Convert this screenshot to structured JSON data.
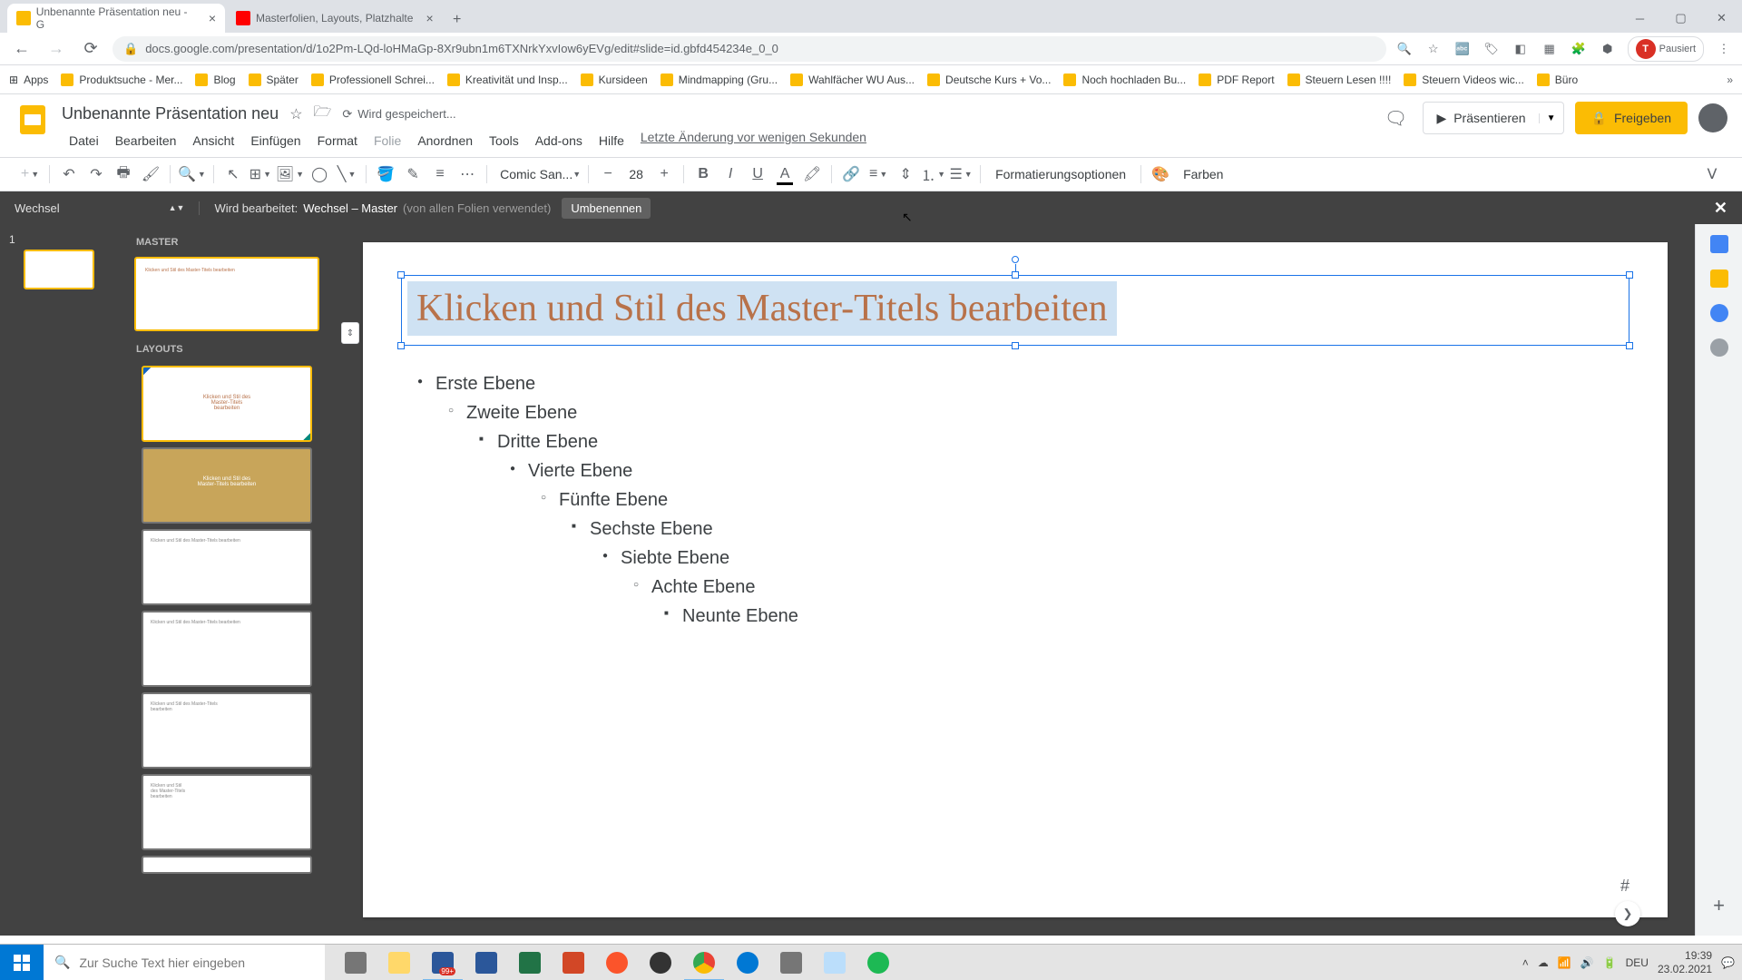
{
  "browser": {
    "tabs": [
      {
        "title": "Unbenannte Präsentation neu - G",
        "active": true
      },
      {
        "title": "Masterfolien, Layouts, Platzhalte",
        "active": false
      }
    ],
    "url": "docs.google.com/presentation/d/1o2Pm-LQd-loHMaGp-8Xr9ubn1m6TXNrkYxvIow6yEVg/edit#slide=id.gbfd454234e_0_0",
    "profile_status": "Pausiert",
    "profile_initial": "T"
  },
  "bookmarks": [
    "Apps",
    "Produktsuche - Mer...",
    "Blog",
    "Später",
    "Professionell Schrei...",
    "Kreativität und Insp...",
    "Kursideen",
    "Mindmapping  (Gru...",
    "Wahlfächer WU Aus...",
    "Deutsche Kurs + Vo...",
    "Noch hochladen Bu...",
    "PDF Report",
    "Steuern Lesen !!!!",
    "Steuern Videos wic...",
    "Büro"
  ],
  "app": {
    "doc_title": "Unbenannte Präsentation neu",
    "saving": "Wird gespeichert...",
    "last_edit": "Letzte Änderung vor wenigen Sekunden",
    "menus": [
      "Datei",
      "Bearbeiten",
      "Ansicht",
      "Einfügen",
      "Format",
      "Folie",
      "Anordnen",
      "Tools",
      "Add-ons",
      "Hilfe"
    ],
    "present": "Präsentieren",
    "share": "Freigeben"
  },
  "toolbar": {
    "font_name": "Comic San...",
    "font_size": "28",
    "format_options": "Formatierungsoptionen",
    "colors": "Farben"
  },
  "master_bar": {
    "theme": "Wechsel",
    "editing_prefix": "Wird bearbeitet:",
    "editing_name": "Wechsel – Master",
    "editing_usage": "(von allen Folien verwendet)",
    "rename": "Umbenennen"
  },
  "panel": {
    "master_label": "MASTER",
    "layouts_label": "LAYOUTS"
  },
  "slide": {
    "title": "Klicken und Stil des Master-Titels bearbeiten",
    "levels": [
      "Erste Ebene",
      "Zweite Ebene",
      "Dritte Ebene",
      "Vierte Ebene",
      "Fünfte Ebene",
      "Sechste Ebene",
      "Siebte Ebene",
      "Achte Ebene",
      "Neunte Ebene"
    ],
    "page_num": "#"
  },
  "filmstrip": {
    "slide_num": "1"
  },
  "taskbar": {
    "search_placeholder": "Zur Suche Text hier eingeben",
    "lang": "DEU",
    "time": "19:39",
    "date": "23.02.2021",
    "notif_count": "99+"
  }
}
